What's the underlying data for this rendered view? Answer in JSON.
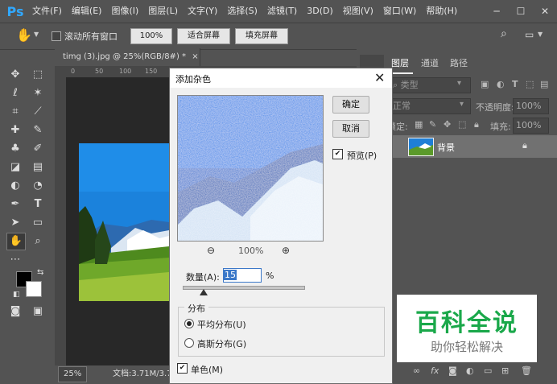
{
  "app": {
    "logo": "Ps"
  },
  "menu": [
    "文件(F)",
    "编辑(E)",
    "图像(I)",
    "图层(L)",
    "文字(Y)",
    "选择(S)",
    "滤镜(T)",
    "3D(D)",
    "视图(V)",
    "窗口(W)",
    "帮助(H)"
  ],
  "window_controls": [
    "─",
    "☐",
    "✕"
  ],
  "options": {
    "scroll_all": "滚动所有窗口",
    "zoom": "100%",
    "fit_screen": "适合屏幕",
    "fill_screen": "填充屏幕"
  },
  "document": {
    "tab": "timg (3).jpg @ 25%(RGB/8#) *",
    "close": "×",
    "ruler_marks": [
      "0",
      "50",
      "100",
      "150"
    ]
  },
  "status": {
    "zoom": "25%",
    "doc": "文档:3.71M/3.71M"
  },
  "panels": {
    "tabs": [
      "图层",
      "通道",
      "路径"
    ],
    "kind": "类型",
    "blend": "正常",
    "opacity_label": "不透明度:",
    "opacity": "100%",
    "lock_label": "锁定:",
    "fill_label": "填充:",
    "fill": "100%",
    "layer_name": "背景"
  },
  "dialog": {
    "title": "添加杂色",
    "ok": "确定",
    "cancel": "取消",
    "preview": "预览(P)",
    "zoom": "100%",
    "amount_label": "数量(A):",
    "amount": "15",
    "percent": "%",
    "distribution": "分布",
    "uniform": "平均分布(U)",
    "gaussian": "高斯分布(G)",
    "mono": "单色(M)"
  },
  "watermark": {
    "title": "百科全说",
    "subtitle": "助你轻松解决"
  }
}
